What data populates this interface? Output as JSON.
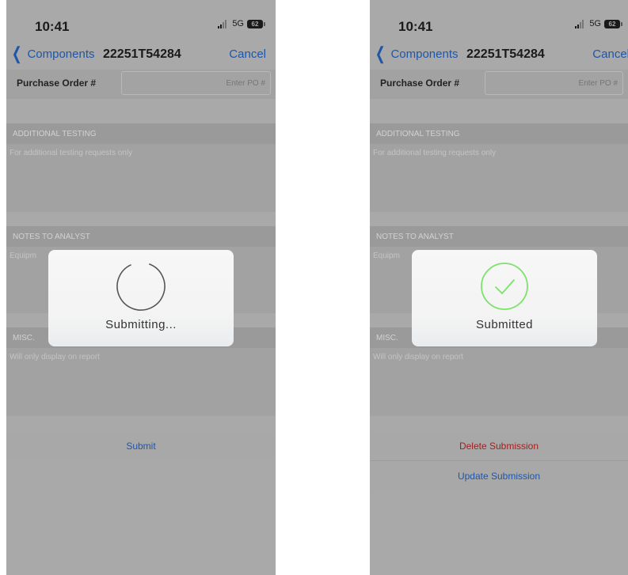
{
  "screens": [
    {
      "status": {
        "time": "10:41",
        "network": "5G",
        "battery": "62"
      },
      "nav": {
        "back_label": "Components",
        "title": "22251T54284",
        "cancel_label": "Cancel"
      },
      "purchase_order": {
        "label": "Purchase Order #",
        "placeholder": "Enter PO #"
      },
      "sections": [
        {
          "header": "ADDITIONAL TESTING",
          "placeholder": "For additional testing requests only"
        },
        {
          "header": "NOTES TO ANALYST",
          "placeholder": "Equipm"
        },
        {
          "header": "MISC.",
          "placeholder": "Will only display on report"
        }
      ],
      "actions": {
        "submit": "Submit"
      },
      "hud": {
        "label": "Submitting...",
        "icon": "spinner-icon"
      }
    },
    {
      "status": {
        "time": "10:41",
        "network": "5G",
        "battery": "62"
      },
      "nav": {
        "back_label": "Components",
        "title": "22251T54284",
        "cancel_label": "Cancel"
      },
      "purchase_order": {
        "label": "Purchase Order #",
        "placeholder": "Enter PO #"
      },
      "sections": [
        {
          "header": "ADDITIONAL TESTING",
          "placeholder": "For additional testing requests only"
        },
        {
          "header": "NOTES TO ANALYST",
          "placeholder": "Equipm"
        },
        {
          "header": "MISC.",
          "placeholder": "Will only display on report"
        }
      ],
      "actions": {
        "delete": "Delete Submission",
        "update": "Update Submission"
      },
      "hud": {
        "label": "Submitted",
        "icon": "checkmark-icon"
      }
    }
  ],
  "colors": {
    "link": "#1f56a8",
    "destructive": "#a31f1f",
    "success": "#7de26a",
    "overlay": "#a9a9a9"
  }
}
